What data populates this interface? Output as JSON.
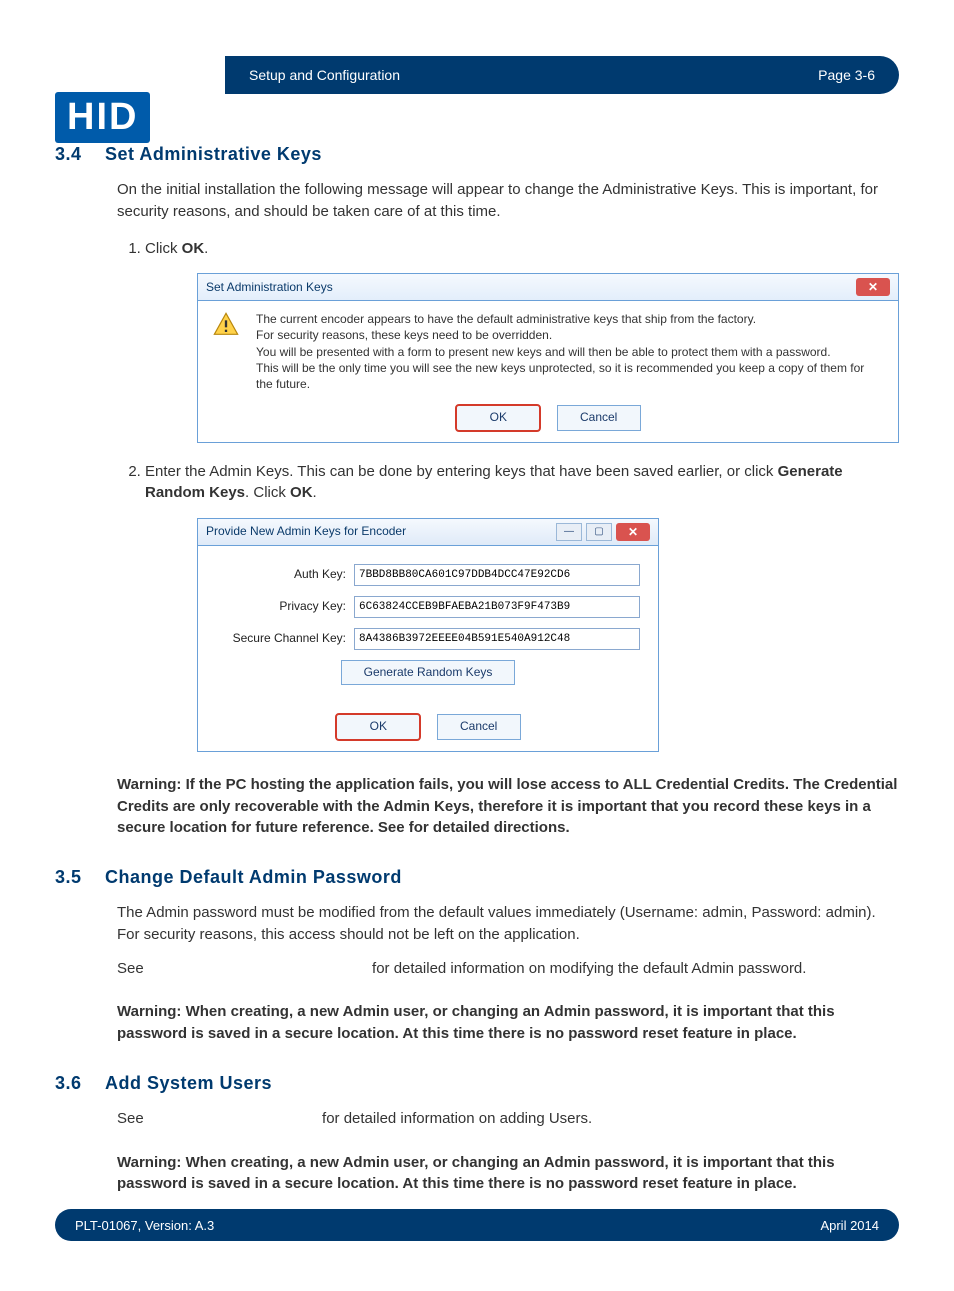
{
  "header": {
    "logo_text": "HID",
    "breadcrumb": "Setup and Configuration",
    "page_label": "Page 3-6"
  },
  "sections": {
    "s34": {
      "num": "3.4",
      "title": "Set Administrative Keys",
      "intro": "On the initial installation the following message will appear to change the Administrative Keys. This is important, for security reasons, and should be taken care of at this time.",
      "step1_pre": "Click ",
      "step1_bold": "OK",
      "step1_post": ".",
      "step2_pre": "Enter the Admin Keys. This can be done by entering keys that have been saved earlier, or click ",
      "step2_bold1": "Generate Random Keys",
      "step2_mid": ". Click ",
      "step2_bold2": "OK",
      "step2_post": ".",
      "warning": "Warning: If the PC hosting the application fails, you will lose access to ALL Credential Credits. The Credential Credits are only recoverable with the Admin Keys, therefore it is important that you record these keys in a secure location for future reference. See                                                       for detailed directions."
    },
    "s35": {
      "num": "3.5",
      "title": "Change Default Admin Password",
      "p1": "The Admin password must be modified from the default values immediately (Username: admin, Password: admin). For security reasons, this access should not be left on the application.",
      "p2_pre": "See ",
      "p2_post": " for detailed information on modifying the default Admin password.",
      "warning": "Warning: When creating, a new Admin user, or changing an Admin password, it is important that this password is saved in a secure location. At this time there is no password reset feature in place."
    },
    "s36": {
      "num": "3.6",
      "title": "Add System Users",
      "p1_pre": "See ",
      "p1_post": " for detailed information on adding Users.",
      "warning": "Warning: When creating, a new Admin user, or changing an Admin password, it is important that this password is saved in a secure location. At this time there is no password reset feature in place."
    }
  },
  "dialog1": {
    "title": "Set Administration Keys",
    "msg_l1": "The current encoder appears to have the default administrative keys that ship from the factory.",
    "msg_l2": "For security reasons, these keys need to be overridden.",
    "msg_l3": "You will be presented with a form to present new keys and will then be able to protect them with a password.",
    "msg_l4": "This will be the only time you will see the new keys unprotected, so it is recommended you keep a copy of them for the future.",
    "ok": "OK",
    "cancel": "Cancel"
  },
  "dialog2": {
    "title": "Provide New Admin Keys for Encoder",
    "auth_label": "Auth Key:",
    "auth_val": "7BBD8BB80CA601C97DDB4DCC47E92CD6",
    "priv_label": "Privacy Key:",
    "priv_val": "6C63824CCEB9BFAEBA21B073F9F473B9",
    "sec_label": "Secure Channel Key:",
    "sec_val": "8A4386B3972EEEE04B591E540A912C48",
    "gen": "Generate Random Keys",
    "ok": "OK",
    "cancel": "Cancel"
  },
  "footer": {
    "doc": "PLT-01067, Version: A.3",
    "date": "April 2014"
  }
}
